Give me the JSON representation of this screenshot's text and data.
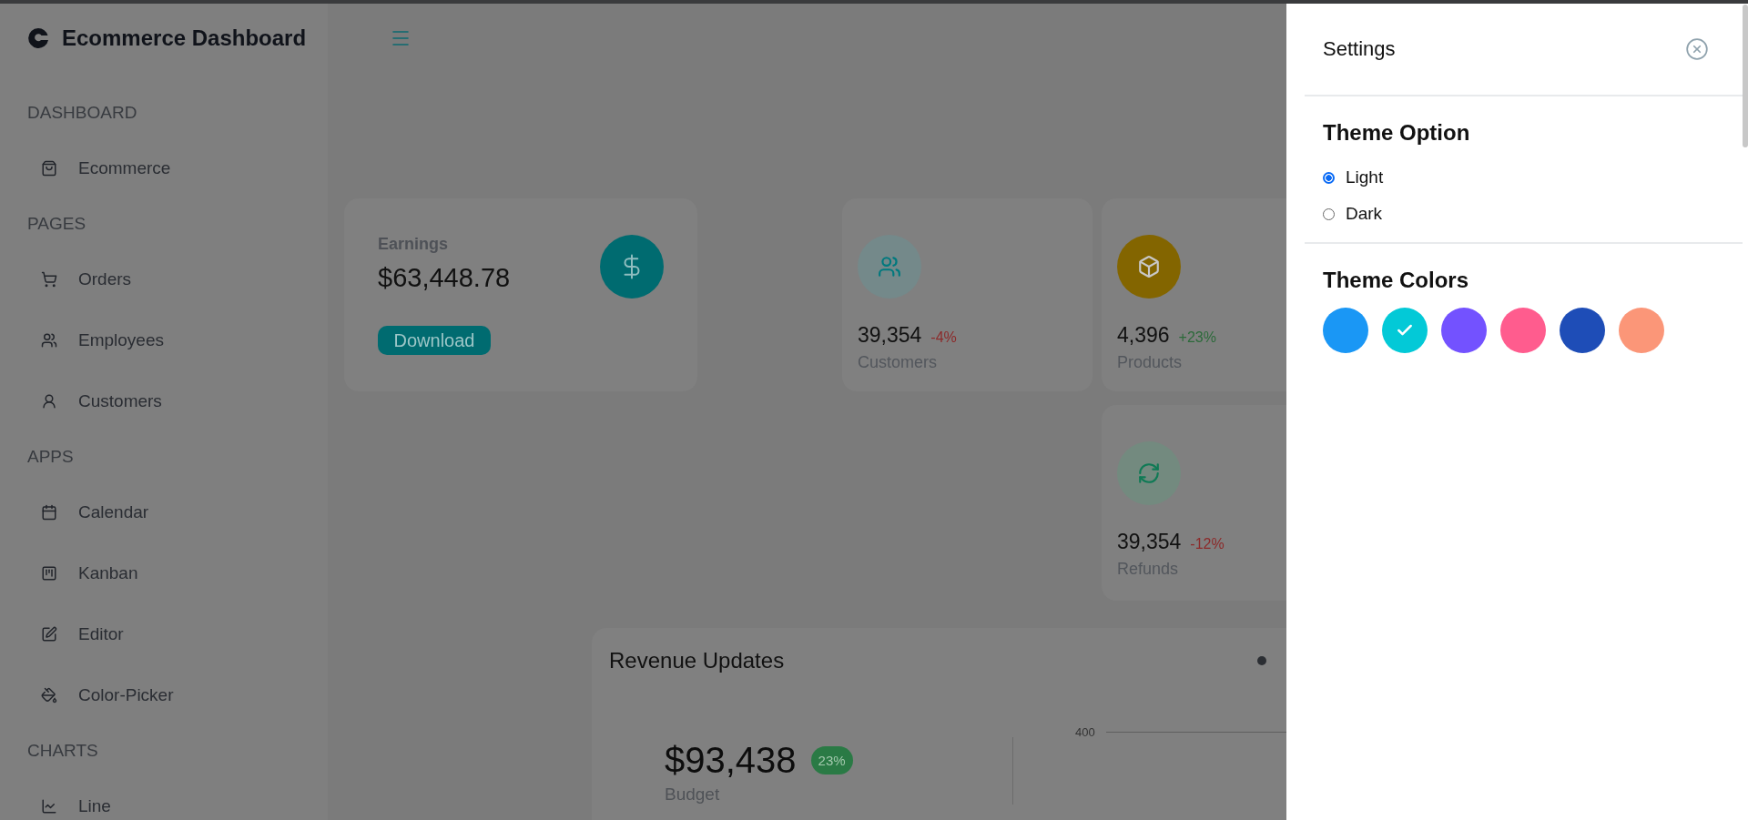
{
  "sidebar": {
    "brand": "Ecommerce Dashboard",
    "sections": [
      {
        "title": "DASHBOARD",
        "items": [
          {
            "label": "Ecommerce"
          }
        ]
      },
      {
        "title": "PAGES",
        "items": [
          {
            "label": "Orders"
          },
          {
            "label": "Employees"
          },
          {
            "label": "Customers"
          }
        ]
      },
      {
        "title": "APPS",
        "items": [
          {
            "label": "Calendar"
          },
          {
            "label": "Kanban"
          },
          {
            "label": "Editor"
          },
          {
            "label": "Color-Picker"
          }
        ]
      },
      {
        "title": "CHARTS",
        "items": [
          {
            "label": "Line"
          }
        ]
      }
    ]
  },
  "earnings": {
    "label": "Earnings",
    "value": "$63,448.78",
    "button": "Download"
  },
  "stats": [
    {
      "value": "39,354",
      "change": {
        "text": "-4%",
        "color": "#8c2a2a"
      },
      "label": "Customers",
      "icon": {
        "color": "#74898a"
      }
    },
    {
      "value": "4,396",
      "change": {
        "text": "+23%",
        "color": "#2c6a3a"
      },
      "label": "Products",
      "icon": {
        "color": "#836500"
      }
    },
    {
      "value": "39,354",
      "change": {
        "text": "-12%",
        "color": "#8c2a2a"
      },
      "label": "Refunds",
      "icon": {
        "color": "#738a7f"
      }
    }
  ],
  "revenue": {
    "title": "Revenue Updates",
    "budget": "$93,438",
    "badge": "23%",
    "budget_label": "Budget",
    "axis_label": "400"
  },
  "settings": {
    "title": "Settings",
    "theme_option": {
      "title": "Theme Option",
      "options": [
        {
          "label": "Light",
          "selected": true
        },
        {
          "label": "Dark",
          "selected": false
        }
      ]
    },
    "theme_colors": {
      "title": "Theme Colors",
      "colors": [
        {
          "color": "#1a97f5",
          "selected": false
        },
        {
          "color": "#03c9d7",
          "selected": true
        },
        {
          "color": "#7352ff",
          "selected": false
        },
        {
          "color": "#ff5c8e",
          "selected": false
        },
        {
          "color": "#1e4db7",
          "selected": false
        },
        {
          "color": "#fb9678",
          "selected": false
        }
      ]
    }
  }
}
